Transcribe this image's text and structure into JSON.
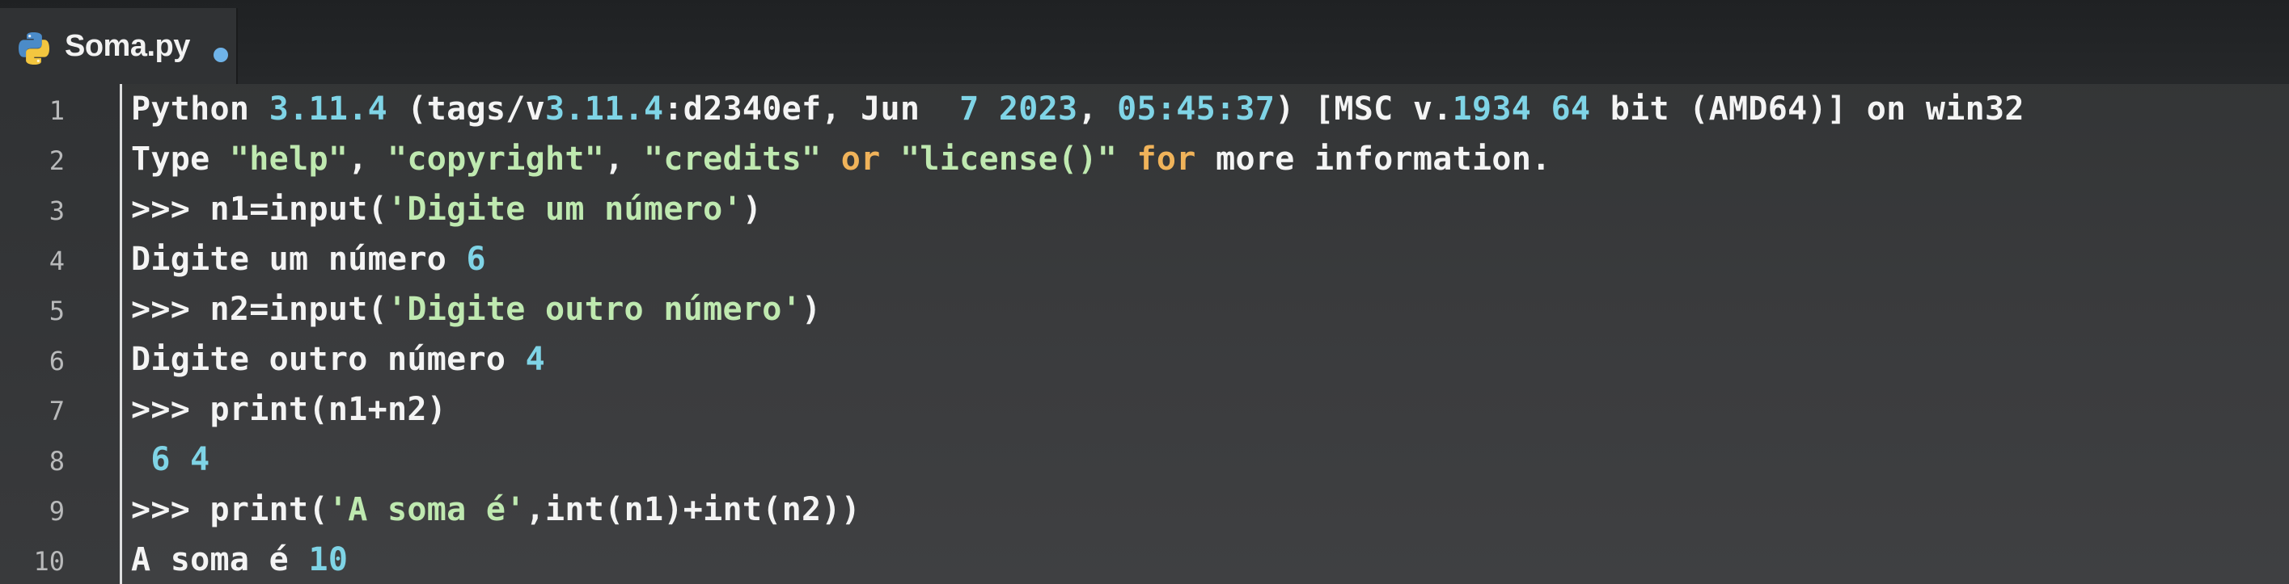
{
  "tab": {
    "filename": "Soma.py",
    "icon": "python-icon",
    "modified_indicator": "unsaved-dot"
  },
  "colors": {
    "number": "#7fd4e6",
    "string": "#bfe9b0",
    "keyword": "#f0b35a",
    "text": "#f4f4f4"
  },
  "lines": [
    {
      "n": "1",
      "segments": [
        {
          "t": "Python ",
          "c": "text"
        },
        {
          "t": "3.11.4",
          "c": "num"
        },
        {
          "t": " (tags/v",
          "c": "text"
        },
        {
          "t": "3.11.4",
          "c": "num"
        },
        {
          "t": ":d2340ef, Jun  ",
          "c": "text"
        },
        {
          "t": "7 2023",
          "c": "num"
        },
        {
          "t": ", ",
          "c": "text"
        },
        {
          "t": "05:45:37",
          "c": "num"
        },
        {
          "t": ") [MSC v.",
          "c": "text"
        },
        {
          "t": "1934 64",
          "c": "num"
        },
        {
          "t": " bit (AMD64)] on win32",
          "c": "text"
        }
      ]
    },
    {
      "n": "2",
      "segments": [
        {
          "t": "Type ",
          "c": "text"
        },
        {
          "t": "\"help\"",
          "c": "str"
        },
        {
          "t": ", ",
          "c": "text"
        },
        {
          "t": "\"copyright\"",
          "c": "str"
        },
        {
          "t": ", ",
          "c": "text"
        },
        {
          "t": "\"credits\"",
          "c": "str"
        },
        {
          "t": " ",
          "c": "text"
        },
        {
          "t": "or",
          "c": "kw"
        },
        {
          "t": " ",
          "c": "text"
        },
        {
          "t": "\"license()\"",
          "c": "str"
        },
        {
          "t": " ",
          "c": "text"
        },
        {
          "t": "for",
          "c": "kw"
        },
        {
          "t": " more information.",
          "c": "text"
        }
      ]
    },
    {
      "n": "3",
      "segments": [
        {
          "t": ">>> n1=input(",
          "c": "text"
        },
        {
          "t": "'Digite um número'",
          "c": "str"
        },
        {
          "t": ")",
          "c": "text"
        }
      ]
    },
    {
      "n": "4",
      "segments": [
        {
          "t": "Digite um número ",
          "c": "text"
        },
        {
          "t": "6",
          "c": "num"
        }
      ]
    },
    {
      "n": "5",
      "segments": [
        {
          "t": ">>> n2=input(",
          "c": "text"
        },
        {
          "t": "'Digite outro número'",
          "c": "str"
        },
        {
          "t": ")",
          "c": "text"
        }
      ]
    },
    {
      "n": "6",
      "segments": [
        {
          "t": "Digite outro número ",
          "c": "text"
        },
        {
          "t": "4",
          "c": "num"
        }
      ]
    },
    {
      "n": "7",
      "segments": [
        {
          "t": ">>> print(n1+n2)",
          "c": "text"
        }
      ]
    },
    {
      "n": "8",
      "segments": [
        {
          "t": " 6 4",
          "c": "num"
        }
      ]
    },
    {
      "n": "9",
      "segments": [
        {
          "t": ">>> print(",
          "c": "text"
        },
        {
          "t": "'A soma é'",
          "c": "str"
        },
        {
          "t": ",int(n1)+int(n2))",
          "c": "text"
        }
      ]
    },
    {
      "n": "10",
      "segments": [
        {
          "t": "A soma é ",
          "c": "text"
        },
        {
          "t": "10",
          "c": "num"
        }
      ]
    }
  ]
}
